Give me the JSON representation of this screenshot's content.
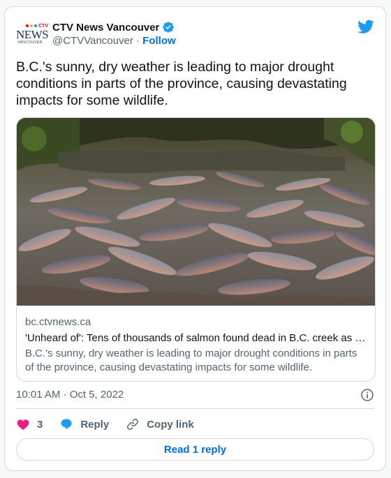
{
  "author": {
    "logo_top": "CTV",
    "logo_main": "NEWS",
    "logo_city": "VANCOUVER",
    "display_name": "CTV News Vancouver",
    "handle": "@CTVVancouver",
    "separator": "·",
    "follow_label": "Follow",
    "verified_icon": "verified-badge-icon",
    "brand_icon": "twitter-bird-icon"
  },
  "tweet": {
    "text": "B.C.'s sunny, dry weather is leading to major drought conditions in parts of the province, causing devastating impacts for some wildlife."
  },
  "link_card": {
    "domain": "bc.ctvnews.ca",
    "title": "'Unheard of': Tens of thousands of salmon found dead in B.C. creek as drought continues",
    "description": "B.C.'s sunny, dry weather is leading to major drought conditions in parts of the province, causing devastating impacts for some wildlife."
  },
  "meta": {
    "timestamp": "10:01 AM · Oct 5, 2022",
    "info_icon": "info-icon"
  },
  "actions": {
    "like_count": "3",
    "reply_label": "Reply",
    "copy_link_label": "Copy link"
  },
  "footer": {
    "read_replies_label": "Read 1 reply"
  },
  "colors": {
    "accent": "#1d9bf0",
    "link": "#006fd6",
    "heart": "#f91880",
    "secondary_text": "#536471",
    "border": "#cfd9de"
  }
}
